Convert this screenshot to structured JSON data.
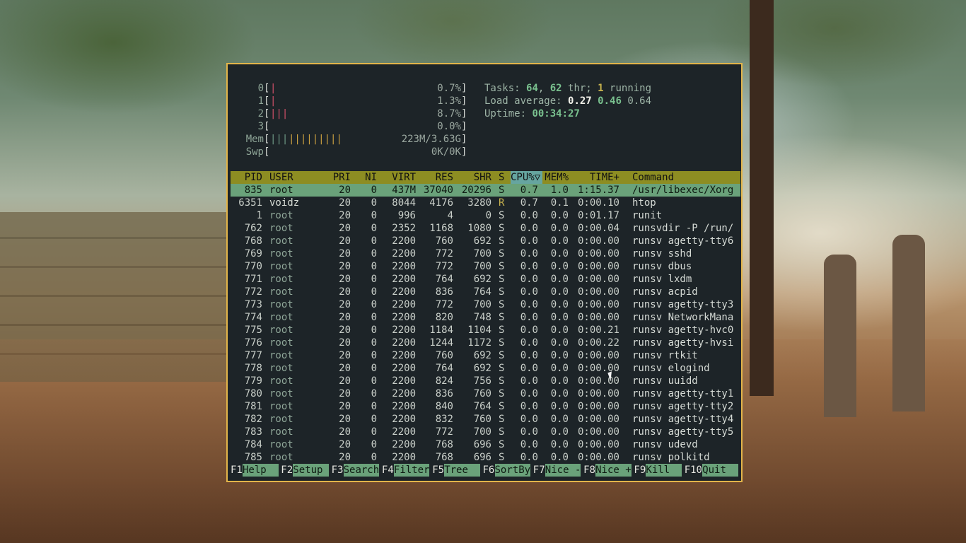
{
  "meters": {
    "cpus": [
      {
        "label": "0",
        "bars": "|",
        "value": "0.7%"
      },
      {
        "label": "1",
        "bars": "|",
        "value": "1.3%"
      },
      {
        "label": "2",
        "bars": "|||",
        "value": "8.7%"
      },
      {
        "label": "3",
        "bars": "",
        "value": "0.0%"
      }
    ],
    "mem": {
      "label": "Mem",
      "bars_a": "|||",
      "bars_b": "|||||||||",
      "value": "223M/3.63G"
    },
    "swp": {
      "label": "Swp",
      "value": "0K/0K"
    }
  },
  "summary": {
    "tasks_label": "Tasks: ",
    "tasks": "64",
    "sep1": ", ",
    "threads": "62",
    "thr_label": " thr; ",
    "running": "1",
    "running_label": " running",
    "load_label": "Load average: ",
    "load1": "0.27",
    "load5": "0.46",
    "load15": "0.64",
    "uptime_label": "Uptime: ",
    "uptime": "00:34:27"
  },
  "columns": {
    "pid": "PID",
    "user": "USER",
    "pri": "PRI",
    "ni": "NI",
    "virt": "VIRT",
    "res": "RES",
    "shr": "SHR",
    "s": "S",
    "cpu": "CPU%▽",
    "mem": "MEM%",
    "time": "TIME+",
    "command": "Command"
  },
  "processes": [
    {
      "pid": "835",
      "user": "root",
      "pri": "20",
      "ni": "0",
      "virt": "437M",
      "res": "37040",
      "shr": "20296",
      "s": "S",
      "cpu": "0.7",
      "mem": "1.0",
      "time": "1:15.37",
      "command": "/usr/libexec/Xorg",
      "selected": true
    },
    {
      "pid": "6351",
      "user": "voidz",
      "pri": "20",
      "ni": "0",
      "virt": "8044",
      "res": "4176",
      "shr": "3280",
      "s": "R",
      "cpu": "0.7",
      "mem": "0.1",
      "time": "0:00.10",
      "command": "htop"
    },
    {
      "pid": "1",
      "user": "root",
      "pri": "20",
      "ni": "0",
      "virt": "996",
      "res": "4",
      "shr": "0",
      "s": "S",
      "cpu": "0.0",
      "mem": "0.0",
      "time": "0:01.17",
      "command": "runit"
    },
    {
      "pid": "762",
      "user": "root",
      "pri": "20",
      "ni": "0",
      "virt": "2352",
      "res": "1168",
      "shr": "1080",
      "s": "S",
      "cpu": "0.0",
      "mem": "0.0",
      "time": "0:00.04",
      "command": "runsvdir -P /run/"
    },
    {
      "pid": "768",
      "user": "root",
      "pri": "20",
      "ni": "0",
      "virt": "2200",
      "res": "760",
      "shr": "692",
      "s": "S",
      "cpu": "0.0",
      "mem": "0.0",
      "time": "0:00.00",
      "command": "runsv agetty-tty6"
    },
    {
      "pid": "769",
      "user": "root",
      "pri": "20",
      "ni": "0",
      "virt": "2200",
      "res": "772",
      "shr": "700",
      "s": "S",
      "cpu": "0.0",
      "mem": "0.0",
      "time": "0:00.00",
      "command": "runsv sshd"
    },
    {
      "pid": "770",
      "user": "root",
      "pri": "20",
      "ni": "0",
      "virt": "2200",
      "res": "772",
      "shr": "700",
      "s": "S",
      "cpu": "0.0",
      "mem": "0.0",
      "time": "0:00.00",
      "command": "runsv dbus"
    },
    {
      "pid": "771",
      "user": "root",
      "pri": "20",
      "ni": "0",
      "virt": "2200",
      "res": "764",
      "shr": "692",
      "s": "S",
      "cpu": "0.0",
      "mem": "0.0",
      "time": "0:00.00",
      "command": "runsv lxdm"
    },
    {
      "pid": "772",
      "user": "root",
      "pri": "20",
      "ni": "0",
      "virt": "2200",
      "res": "836",
      "shr": "764",
      "s": "S",
      "cpu": "0.0",
      "mem": "0.0",
      "time": "0:00.00",
      "command": "runsv acpid"
    },
    {
      "pid": "773",
      "user": "root",
      "pri": "20",
      "ni": "0",
      "virt": "2200",
      "res": "772",
      "shr": "700",
      "s": "S",
      "cpu": "0.0",
      "mem": "0.0",
      "time": "0:00.00",
      "command": "runsv agetty-tty3"
    },
    {
      "pid": "774",
      "user": "root",
      "pri": "20",
      "ni": "0",
      "virt": "2200",
      "res": "820",
      "shr": "748",
      "s": "S",
      "cpu": "0.0",
      "mem": "0.0",
      "time": "0:00.00",
      "command": "runsv NetworkMana"
    },
    {
      "pid": "775",
      "user": "root",
      "pri": "20",
      "ni": "0",
      "virt": "2200",
      "res": "1184",
      "shr": "1104",
      "s": "S",
      "cpu": "0.0",
      "mem": "0.0",
      "time": "0:00.21",
      "command": "runsv agetty-hvc0"
    },
    {
      "pid": "776",
      "user": "root",
      "pri": "20",
      "ni": "0",
      "virt": "2200",
      "res": "1244",
      "shr": "1172",
      "s": "S",
      "cpu": "0.0",
      "mem": "0.0",
      "time": "0:00.22",
      "command": "runsv agetty-hvsi"
    },
    {
      "pid": "777",
      "user": "root",
      "pri": "20",
      "ni": "0",
      "virt": "2200",
      "res": "760",
      "shr": "692",
      "s": "S",
      "cpu": "0.0",
      "mem": "0.0",
      "time": "0:00.00",
      "command": "runsv rtkit"
    },
    {
      "pid": "778",
      "user": "root",
      "pri": "20",
      "ni": "0",
      "virt": "2200",
      "res": "764",
      "shr": "692",
      "s": "S",
      "cpu": "0.0",
      "mem": "0.0",
      "time": "0:00.00",
      "command": "runsv elogind"
    },
    {
      "pid": "779",
      "user": "root",
      "pri": "20",
      "ni": "0",
      "virt": "2200",
      "res": "824",
      "shr": "756",
      "s": "S",
      "cpu": "0.0",
      "mem": "0.0",
      "time": "0:00.00",
      "command": "runsv uuidd"
    },
    {
      "pid": "780",
      "user": "root",
      "pri": "20",
      "ni": "0",
      "virt": "2200",
      "res": "836",
      "shr": "760",
      "s": "S",
      "cpu": "0.0",
      "mem": "0.0",
      "time": "0:00.00",
      "command": "runsv agetty-tty1"
    },
    {
      "pid": "781",
      "user": "root",
      "pri": "20",
      "ni": "0",
      "virt": "2200",
      "res": "840",
      "shr": "764",
      "s": "S",
      "cpu": "0.0",
      "mem": "0.0",
      "time": "0:00.00",
      "command": "runsv agetty-tty2"
    },
    {
      "pid": "782",
      "user": "root",
      "pri": "20",
      "ni": "0",
      "virt": "2200",
      "res": "832",
      "shr": "760",
      "s": "S",
      "cpu": "0.0",
      "mem": "0.0",
      "time": "0:00.00",
      "command": "runsv agetty-tty4"
    },
    {
      "pid": "783",
      "user": "root",
      "pri": "20",
      "ni": "0",
      "virt": "2200",
      "res": "772",
      "shr": "700",
      "s": "S",
      "cpu": "0.0",
      "mem": "0.0",
      "time": "0:00.00",
      "command": "runsv agetty-tty5"
    },
    {
      "pid": "784",
      "user": "root",
      "pri": "20",
      "ni": "0",
      "virt": "2200",
      "res": "768",
      "shr": "696",
      "s": "S",
      "cpu": "0.0",
      "mem": "0.0",
      "time": "0:00.00",
      "command": "runsv udevd"
    },
    {
      "pid": "785",
      "user": "root",
      "pri": "20",
      "ni": "0",
      "virt": "2200",
      "res": "768",
      "shr": "696",
      "s": "S",
      "cpu": "0.0",
      "mem": "0.0",
      "time": "0:00.00",
      "command": "runsv polkitd"
    }
  ],
  "function_keys": [
    {
      "key": "F1",
      "label": "Help  "
    },
    {
      "key": "F2",
      "label": "Setup "
    },
    {
      "key": "F3",
      "label": "Search"
    },
    {
      "key": "F4",
      "label": "Filter"
    },
    {
      "key": "F5",
      "label": "Tree  "
    },
    {
      "key": "F6",
      "label": "SortBy"
    },
    {
      "key": "F7",
      "label": "Nice -"
    },
    {
      "key": "F8",
      "label": "Nice +"
    },
    {
      "key": "F9",
      "label": "Kill  "
    },
    {
      "key": "F10",
      "label": "Quit  "
    }
  ],
  "colors": {
    "frame": "#e2b44a",
    "terminal_bg": "#1d2428",
    "header_bg": "#8d8d22",
    "selected_bg": "#6aa27a",
    "sort_col_bg": "#66a5a0"
  }
}
